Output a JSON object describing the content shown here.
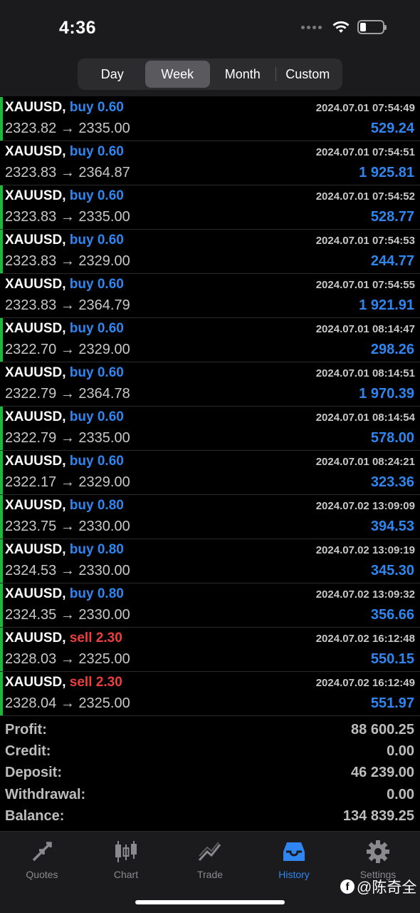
{
  "status_bar": {
    "time": "4:36"
  },
  "segments": [
    {
      "label": "Day",
      "active": false
    },
    {
      "label": "Week",
      "active": true
    },
    {
      "label": "Month",
      "active": false
    },
    {
      "label": "Custom",
      "active": false
    }
  ],
  "trades": [
    {
      "symbol": "XAUUSD,",
      "side": "buy",
      "volume": "0.60",
      "time": "2024.07.01 07:54:49",
      "open": "2323.82",
      "arrow": "→",
      "close": "2335.00",
      "profit": "529.24",
      "marker": true
    },
    {
      "symbol": "XAUUSD,",
      "side": "buy",
      "volume": "0.60",
      "time": "2024.07.01 07:54:51",
      "open": "2323.83",
      "arrow": "→",
      "close": "2364.87",
      "profit": "1 925.81",
      "marker": false
    },
    {
      "symbol": "XAUUSD,",
      "side": "buy",
      "volume": "0.60",
      "time": "2024.07.01 07:54:52",
      "open": "2323.83",
      "arrow": "→",
      "close": "2335.00",
      "profit": "528.77",
      "marker": true
    },
    {
      "symbol": "XAUUSD,",
      "side": "buy",
      "volume": "0.60",
      "time": "2024.07.01 07:54:53",
      "open": "2323.83",
      "arrow": "→",
      "close": "2329.00",
      "profit": "244.77",
      "marker": true
    },
    {
      "symbol": "XAUUSD,",
      "side": "buy",
      "volume": "0.60",
      "time": "2024.07.01 07:54:55",
      "open": "2323.83",
      "arrow": "→",
      "close": "2364.79",
      "profit": "1 921.91",
      "marker": false
    },
    {
      "symbol": "XAUUSD,",
      "side": "buy",
      "volume": "0.60",
      "time": "2024.07.01 08:14:47",
      "open": "2322.70",
      "arrow": "→",
      "close": "2329.00",
      "profit": "298.26",
      "marker": true
    },
    {
      "symbol": "XAUUSD,",
      "side": "buy",
      "volume": "0.60",
      "time": "2024.07.01 08:14:51",
      "open": "2322.79",
      "arrow": "→",
      "close": "2364.78",
      "profit": "1 970.39",
      "marker": false
    },
    {
      "symbol": "XAUUSD,",
      "side": "buy",
      "volume": "0.60",
      "time": "2024.07.01 08:14:54",
      "open": "2322.79",
      "arrow": "→",
      "close": "2335.00",
      "profit": "578.00",
      "marker": true
    },
    {
      "symbol": "XAUUSD,",
      "side": "buy",
      "volume": "0.60",
      "time": "2024.07.01 08:24:21",
      "open": "2322.17",
      "arrow": "→",
      "close": "2329.00",
      "profit": "323.36",
      "marker": true
    },
    {
      "symbol": "XAUUSD,",
      "side": "buy",
      "volume": "0.80",
      "time": "2024.07.02 13:09:09",
      "open": "2323.75",
      "arrow": "→",
      "close": "2330.00",
      "profit": "394.53",
      "marker": true
    },
    {
      "symbol": "XAUUSD,",
      "side": "buy",
      "volume": "0.80",
      "time": "2024.07.02 13:09:19",
      "open": "2324.53",
      "arrow": "→",
      "close": "2330.00",
      "profit": "345.30",
      "marker": true
    },
    {
      "symbol": "XAUUSD,",
      "side": "buy",
      "volume": "0.80",
      "time": "2024.07.02 13:09:32",
      "open": "2324.35",
      "arrow": "→",
      "close": "2330.00",
      "profit": "356.66",
      "marker": true
    },
    {
      "symbol": "XAUUSD,",
      "side": "sell",
      "volume": "2.30",
      "time": "2024.07.02 16:12:48",
      "open": "2328.03",
      "arrow": "→",
      "close": "2325.00",
      "profit": "550.15",
      "marker": true
    },
    {
      "symbol": "XAUUSD,",
      "side": "sell",
      "volume": "2.30",
      "time": "2024.07.02 16:12:49",
      "open": "2328.04",
      "arrow": "→",
      "close": "2325.00",
      "profit": "551.97",
      "marker": true
    }
  ],
  "summary": [
    {
      "label": "Profit:",
      "value": "88 600.25"
    },
    {
      "label": "Credit:",
      "value": "0.00"
    },
    {
      "label": "Deposit:",
      "value": "46 239.00"
    },
    {
      "label": "Withdrawal:",
      "value": "0.00"
    },
    {
      "label": "Balance:",
      "value": "134 839.25"
    }
  ],
  "tabs": [
    {
      "label": "Quotes",
      "icon": "quotes-arrows-icon",
      "active": false
    },
    {
      "label": "Chart",
      "icon": "candlestick-icon",
      "active": false
    },
    {
      "label": "Trade",
      "icon": "trend-line-icon",
      "active": false
    },
    {
      "label": "History",
      "icon": "inbox-tray-icon",
      "active": true
    },
    {
      "label": "Settings",
      "icon": "gear-icon",
      "active": false
    }
  ],
  "watermark": {
    "text": "@陈奇全"
  },
  "colors": {
    "buy": "#2f86f0",
    "sell": "#ef3e3e",
    "marker": "#1fb83f",
    "profit": "#2f86f0"
  }
}
